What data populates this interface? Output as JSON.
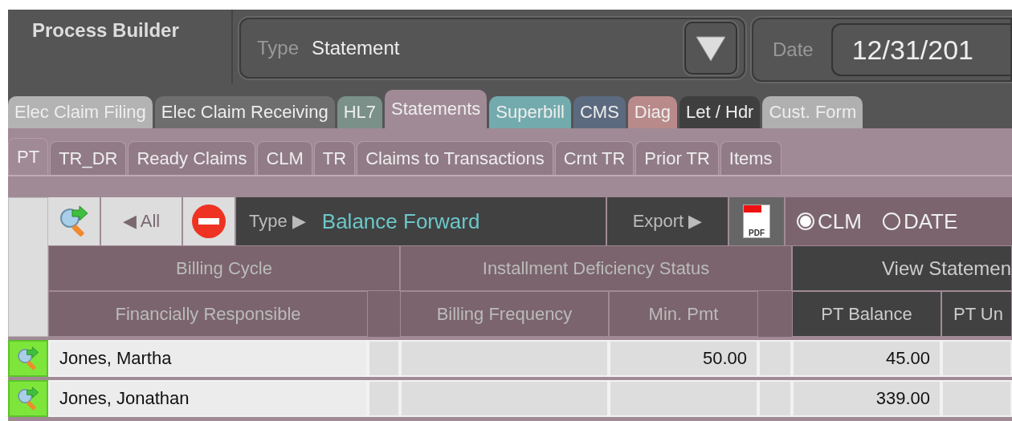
{
  "app_title": "Process Builder",
  "type_field": {
    "label": "Type",
    "value": "Statement"
  },
  "date_field": {
    "label": "Date",
    "value": "12/31/201"
  },
  "tabs": [
    {
      "label": "Elec Claim Filing",
      "color": "#b3b3b3",
      "selected": false
    },
    {
      "label": "Elec Claim Receiving",
      "color": "#6e6e6e",
      "selected": false
    },
    {
      "label": "HL7",
      "color": "#7a9088",
      "selected": false
    },
    {
      "label": "Statements",
      "color": "#a08a95",
      "selected": true
    },
    {
      "label": "Superbill",
      "color": "#73aaad",
      "selected": false
    },
    {
      "label": "CMS",
      "color": "#5c6a80",
      "selected": false
    },
    {
      "label": "Diag",
      "color": "#b98a8a",
      "selected": false
    },
    {
      "label": "Let / Hdr",
      "color": "#3f3f3f",
      "selected": false
    },
    {
      "label": "Cust. Form",
      "color": "#b0b0b0",
      "selected": false
    }
  ],
  "subtabs": [
    {
      "label": "PT",
      "selected": true
    },
    {
      "label": "TR_DR",
      "selected": false
    },
    {
      "label": "Ready Claims",
      "selected": false
    },
    {
      "label": "CLM",
      "selected": false
    },
    {
      "label": "TR",
      "selected": false
    },
    {
      "label": "Claims to Transactions",
      "selected": false
    },
    {
      "label": "Crnt TR",
      "selected": false
    },
    {
      "label": "Prior TR",
      "selected": false
    },
    {
      "label": "Items",
      "selected": false
    }
  ],
  "toolbar": {
    "all_button": "◀ All",
    "type_label": "Type ▶",
    "type_value": "Balance Forward",
    "export_label": "Export ▶",
    "pdf_label": "PDF",
    "radios": [
      {
        "label": "CLM",
        "selected": true
      },
      {
        "label": "DATE",
        "selected": false
      }
    ]
  },
  "table": {
    "group_headers": [
      "Billing Cycle",
      "Installment Deficiency Status",
      "View Statemen"
    ],
    "columns": [
      "Financially Responsible",
      "Billing Frequency",
      "Min. Pmt",
      "PT Balance",
      "PT Un"
    ],
    "rows": [
      {
        "name": "Jones, Martha",
        "min_pmt": "50.00",
        "pt_balance": "45.00"
      },
      {
        "name": "Jones, Jonathan",
        "pt_balance": "339.00"
      }
    ]
  }
}
